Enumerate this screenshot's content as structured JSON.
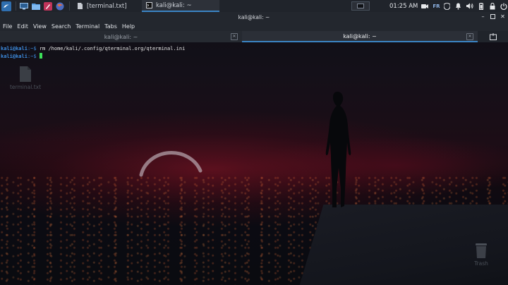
{
  "taskbar": {
    "launcher_icons": [
      "kali-menu-icon",
      "desktop-icon",
      "files-icon",
      "text-editor-icon",
      "browser-icon"
    ],
    "tasks": [
      {
        "label": "[terminal.txt]",
        "icon": "text-file-icon",
        "active": false
      },
      {
        "label": "kali@kali: ~",
        "icon": "terminal-icon",
        "active": true
      }
    ],
    "clock": "01:25 AM",
    "keyboard_layout": "FR",
    "tray_icons": [
      "camera-icon",
      "keyboard-icon",
      "shield-icon",
      "notification-icon",
      "volume-icon",
      "battery-icon",
      "lock-icon",
      "power-icon"
    ],
    "accent_color": "#3b84c4"
  },
  "window": {
    "title": "kali@kali: ~",
    "menu": [
      "File",
      "Edit",
      "View",
      "Search",
      "Terminal",
      "Tabs",
      "Help"
    ],
    "tabs": [
      {
        "label": "kali@kali: ~",
        "active": false
      },
      {
        "label": "kali@kali: ~",
        "active": true
      }
    ]
  },
  "terminal": {
    "lines": [
      {
        "user": "kali",
        "sep": "@",
        "host": "kali",
        "path": ":~$",
        "command": " rm /home/kali/.config/qterminal.org/qterminal.ini"
      },
      {
        "user": "kali",
        "sep": "@",
        "host": "kali",
        "path": ":~$",
        "command": " "
      }
    ],
    "prompt_color": "#3d8de0",
    "cursor_color": "#3de05a"
  },
  "desktop": {
    "icons": [
      {
        "label": "terminal.txt"
      },
      {
        "label": "Trash"
      }
    ]
  }
}
